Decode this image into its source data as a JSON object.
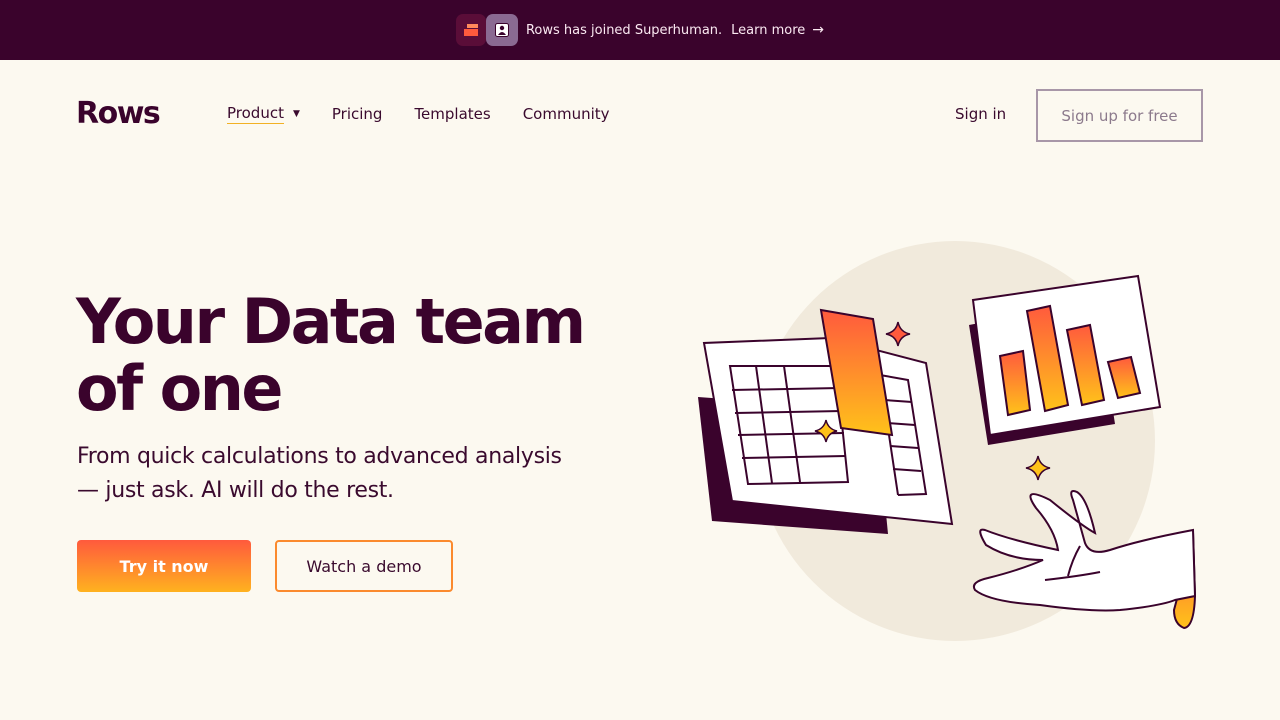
{
  "banner": {
    "text": "Rows has joined Superhuman.",
    "link_label": "Learn more",
    "icons": [
      "rows-logo-icon",
      "superhuman-logo-icon",
      "arrow-right-icon"
    ]
  },
  "nav": {
    "brand": "Rows",
    "items": [
      {
        "label": "Product",
        "has_dropdown": true
      },
      {
        "label": "Pricing"
      },
      {
        "label": "Templates"
      },
      {
        "label": "Community"
      }
    ],
    "signin_label": "Sign in",
    "signup_label": "Sign up for free"
  },
  "hero": {
    "title_line1": "Your Data team",
    "title_line2": "of one",
    "subtitle_line1": "From quick calculations to advanced analysis",
    "subtitle_line2": "— just ask. AI will do the rest.",
    "primary_cta": "Try it now",
    "secondary_cta": "Watch a demo"
  },
  "colors": {
    "banner_bg": "#3a032c",
    "page_bg": "#fcf9f0",
    "text_dark": "#3a032c",
    "accent_orange": "#ff5a3d",
    "accent_yellow": "#ffb21f",
    "illustration_circle": "#f1eadc"
  }
}
